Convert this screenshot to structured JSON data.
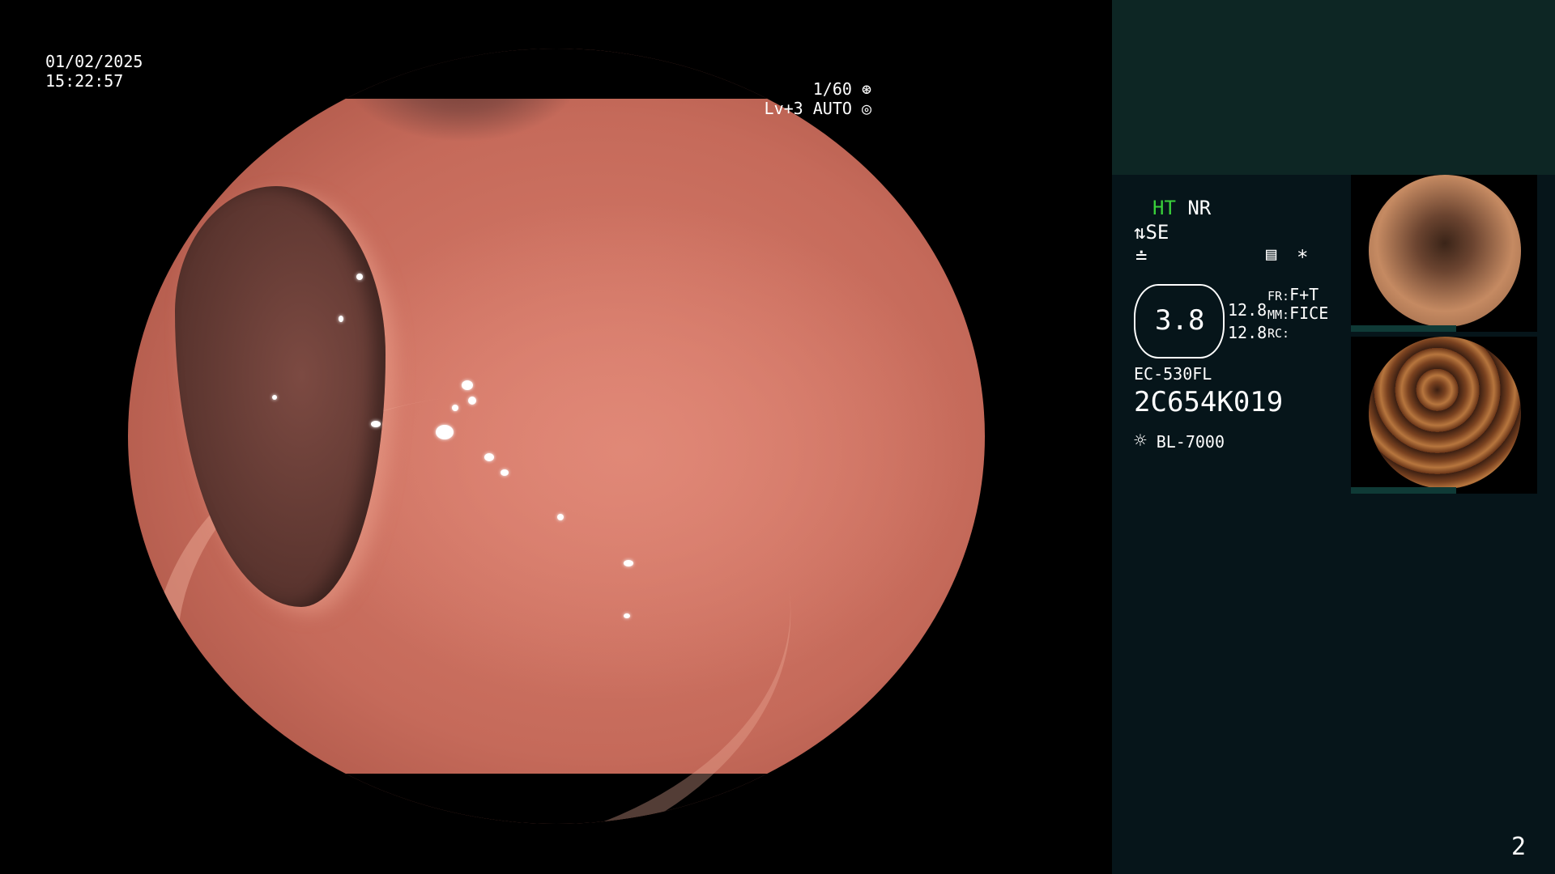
{
  "overlay": {
    "date": "01/02/2025",
    "time": "15:22:57",
    "shutter": "1/60",
    "shutter_icon": "shutter-icon",
    "level": "Lv+3 AUTO",
    "auto_icon": "iris-icon"
  },
  "panel": {
    "mode_ht": "HT",
    "mode_nr": "NR",
    "se_label": "SE",
    "structure_icon": "structure-enhance-icon",
    "noise_icon": "noise-filter-icon",
    "setting_icon": "settings-list-icon",
    "star": "*",
    "zoom": "3.8",
    "value_a": "12.8",
    "value_b": "12.8",
    "fr_label": "FR:",
    "fr_value": "F+T",
    "mm_label": "MM:",
    "mm_value": "FICE",
    "rc_label": "RC:",
    "scope_model": "EC-530FL",
    "serial": "2C654K019",
    "light_icon": "light-source-icon",
    "light_source": "BL-7000"
  },
  "thumbnails": [
    {
      "name": "capture-thumb-1",
      "tone": "#c58a62"
    },
    {
      "name": "capture-thumb-2",
      "tone": "#9a5a34"
    }
  ],
  "page_number": "2"
}
